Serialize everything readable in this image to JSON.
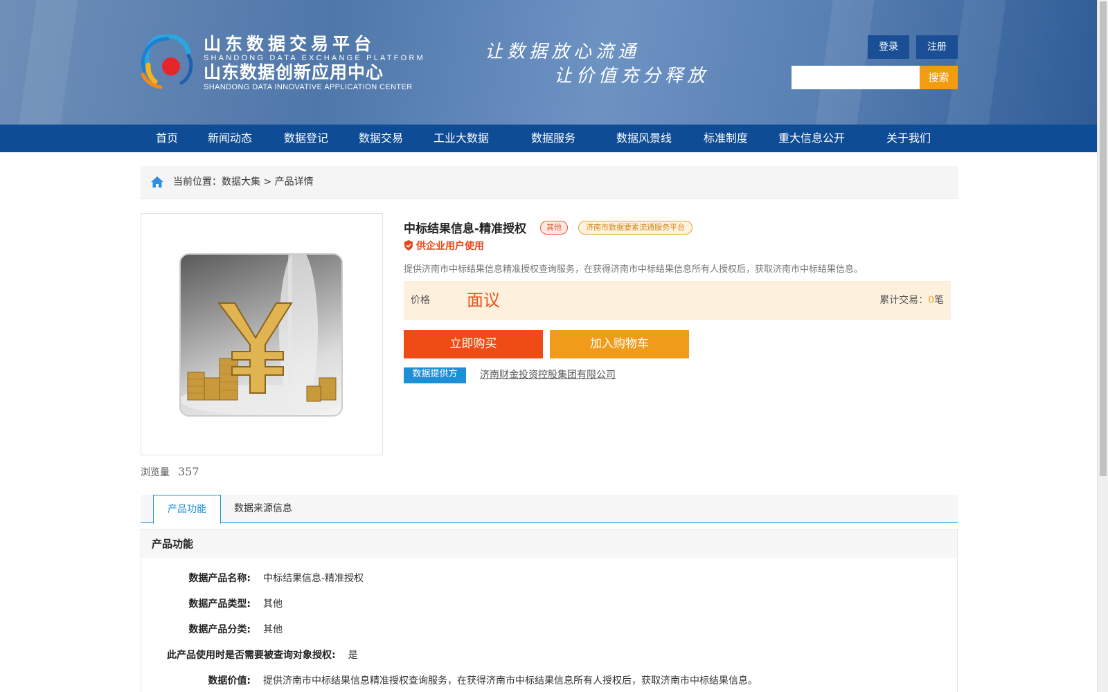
{
  "header": {
    "logo_cn1": "山东数据交易平台",
    "logo_en1": "SHANDONG DATA EXCHANGE PLATFORM",
    "logo_cn2": "山东数据创新应用中心",
    "logo_en2": "SHANDONG DATA INNOVATIVE APPLICATION CENTER",
    "slogan_line1": "让数据放心流通",
    "slogan_line2": "让价值充分释放",
    "login_label": "登录",
    "register_label": "注册",
    "search_placeholder": "",
    "search_label": "搜索"
  },
  "nav": {
    "items": [
      "首页",
      "新闻动态",
      "数据登记",
      "数据交易",
      "工业大数据",
      "数据服务",
      "数据风景线",
      "标准制度",
      "重大信息公开",
      "关于我们"
    ]
  },
  "breadcrumb": {
    "prefix": "当前位置：",
    "level1": "数据大集",
    "separator": " > ",
    "level2": "产品详情"
  },
  "product": {
    "title": "中标结果信息-精准授权",
    "tag_type": "其他",
    "tag_platform": "济南市数据要素流通服务平台",
    "audience": "供企业用户使用",
    "description": "提供济南市中标结果信息精准授权查询服务，在获得济南市中标结果信息所有人授权后，获取济南市中标结果信息。",
    "price_label": "价格",
    "price_value": "面议",
    "trade_label": "累计交易：",
    "trade_count": "0",
    "trade_unit": "笔",
    "buy_label": "立即购买",
    "cart_label": "加入购物车",
    "provider_label": "数据提供方",
    "provider_name": "济南财金投资控股集团有限公司",
    "views_label": "浏览量",
    "views_count": "357"
  },
  "tabs": {
    "active": "产品功能",
    "second": "数据来源信息"
  },
  "features": {
    "heading": "产品功能",
    "rows": [
      {
        "key": "数据产品名称:",
        "value": "中标结果信息-精准授权"
      },
      {
        "key": "数据产品类型:",
        "value": "其他"
      },
      {
        "key": "数据产品分类:",
        "value": "其他"
      },
      {
        "key": "此产品使用时是否需要被查询对象授权:",
        "value": "是"
      },
      {
        "key": "数据价值:",
        "value": "提供济南市中标结果信息精准授权查询服务，在获得济南市中标结果信息所有人授权后，获取济南市中标结果信息。"
      }
    ]
  },
  "colors": {
    "nav_bg": "#0e4c96",
    "accent_orange": "#f39c12",
    "buy_red": "#ee4b15",
    "link_blue": "#1c8fd6"
  }
}
